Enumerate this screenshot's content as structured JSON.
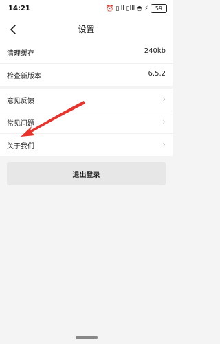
{
  "status_bar": {
    "time": "14:21",
    "time_suffix": "⊙",
    "icons_text": "⏰ ▯lll ▯lll ◓ ⚡",
    "battery": "59"
  },
  "nav": {
    "title": "设置"
  },
  "group1": [
    {
      "label": "清理缓存",
      "value": "240kb"
    },
    {
      "label": "检查新版本",
      "value": "6.5.2"
    }
  ],
  "group2": [
    {
      "label": "意见反馈",
      "chevron": "›"
    },
    {
      "label": "常见问题",
      "chevron": "›"
    },
    {
      "label": "关于我们",
      "chevron": "›"
    }
  ],
  "logout": {
    "label": "退出登录"
  },
  "colors": {
    "annotation_arrow": "#e8322c",
    "background": "#f4f4f4"
  }
}
